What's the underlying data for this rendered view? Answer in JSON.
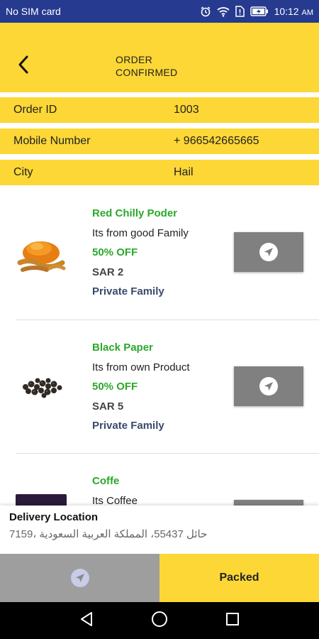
{
  "status_bar": {
    "carrier": "No SIM card",
    "time": "10:12",
    "ampm": "AM",
    "icons": [
      "alarm-icon",
      "wifi-icon",
      "sim-alert-icon",
      "battery-icon"
    ]
  },
  "header": {
    "back_icon": "chevron-left-icon",
    "title_line1": "ORDER",
    "title_line2": "CONFIRMED"
  },
  "order_info": {
    "order_id_label": "Order ID",
    "order_id_value": "1003",
    "mobile_label": "Mobile Number",
    "mobile_value": "+ 966542665665",
    "city_label": "City",
    "city_value": "Hail"
  },
  "products": [
    {
      "name": "Red Chilly Poder",
      "description": "Its from good Family",
      "discount": "50% OFF",
      "price": "SAR 2",
      "seller": "Private Family",
      "action_icon": "navigation-arrow-icon"
    },
    {
      "name": "Black Paper",
      "description": "Its from own Product",
      "discount": "50% OFF",
      "price": "SAR 5",
      "seller": "Private Family",
      "action_icon": "navigation-arrow-icon"
    },
    {
      "name": "Coffe",
      "description": "Its Coffee",
      "action_icon": "navigation-arrow-icon"
    }
  ],
  "delivery": {
    "title": "Delivery Location",
    "address": "7159، حائل 55437، المملكة العربية السعودية"
  },
  "actions": {
    "navigate_icon": "navigation-arrow-icon",
    "packed_label": "Packed"
  },
  "colors": {
    "accent_yellow": "#fcd735",
    "status_bar_blue": "#263a8f",
    "green_text": "#2aa82a",
    "button_gray": "#808080"
  }
}
